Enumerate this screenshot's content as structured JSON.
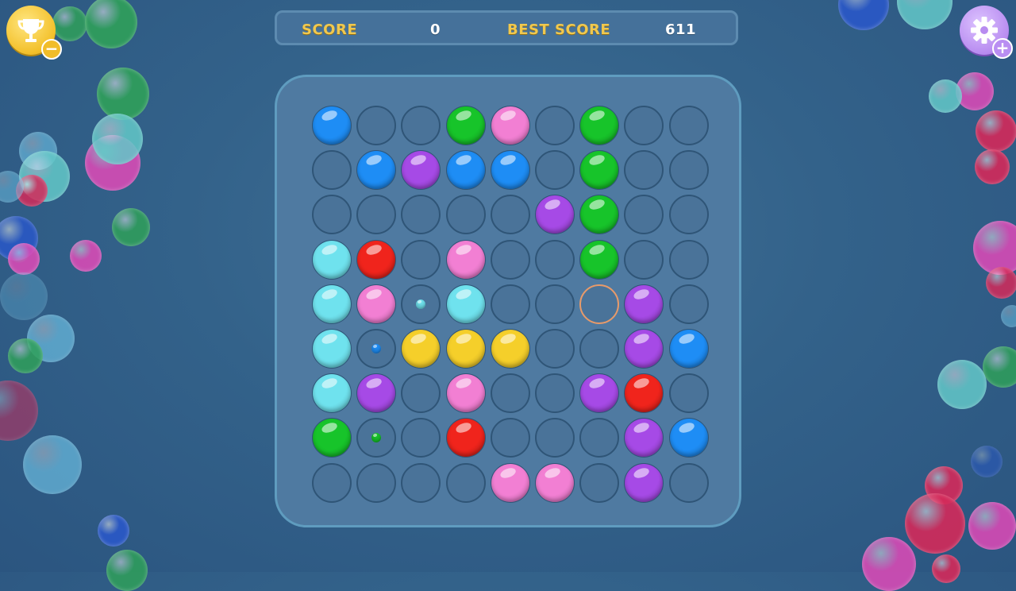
{
  "header": {
    "score_label": "SCORE",
    "score_value": "0",
    "best_label": "BEST SCORE",
    "best_value": "611"
  },
  "buttons": {
    "trophy_icon": "trophy-icon",
    "minus_symbol": "−",
    "settings_icon": "gear-icon",
    "plus_symbol": "+"
  },
  "colors": {
    "blue": "#1e8df5",
    "green": "#17c42a",
    "pink": "#f27fd3",
    "purple": "#a64ae6",
    "cyan": "#6fe2ee",
    "red": "#f0241c",
    "yellow": "#f5cf2a"
  },
  "board": {
    "rows": 9,
    "cols": 9,
    "selected_cell": [
      4,
      6
    ],
    "grid": [
      [
        "blue",
        "",
        "",
        "green",
        "pink",
        "",
        "green",
        "",
        ""
      ],
      [
        "",
        "blue",
        "purple",
        "blue",
        "blue",
        "",
        "green",
        "",
        ""
      ],
      [
        "",
        "",
        "",
        "",
        "",
        "purple",
        "green",
        "",
        ""
      ],
      [
        "cyan",
        "red",
        "",
        "pink",
        "",
        "",
        "green",
        "",
        ""
      ],
      [
        "cyan",
        "pink",
        "cyan:small",
        "cyan",
        "",
        "",
        "",
        "purple",
        ""
      ],
      [
        "cyan",
        "blue:small",
        "yellow",
        "yellow",
        "yellow",
        "",
        "",
        "purple",
        "blue"
      ],
      [
        "cyan",
        "purple",
        "",
        "pink",
        "",
        "",
        "purple",
        "red",
        ""
      ],
      [
        "green",
        "green:small",
        "",
        "red",
        "",
        "",
        "",
        "purple",
        "blue"
      ],
      [
        "",
        "",
        "",
        "",
        "pink",
        "pink",
        "",
        "purple",
        ""
      ]
    ]
  }
}
